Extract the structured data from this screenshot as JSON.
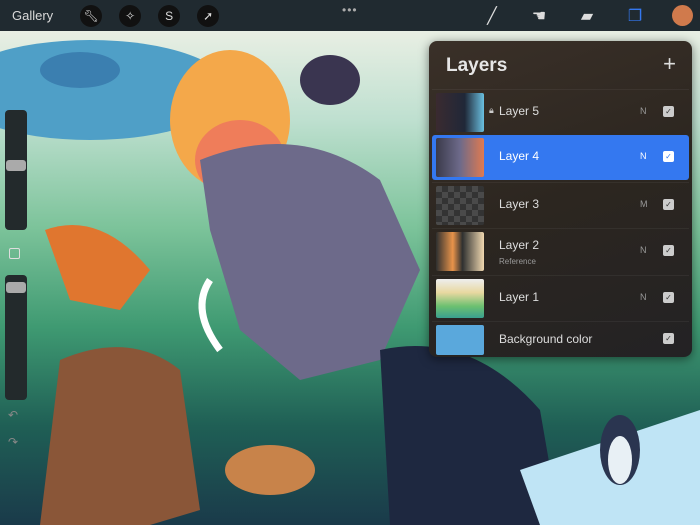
{
  "topbar": {
    "gallery": "Gallery",
    "more": "•••",
    "left_tools": [
      "wrench-icon",
      "magic-wand-icon",
      "selection-icon",
      "transform-arrow-icon"
    ],
    "right_tools": [
      "brush-icon",
      "smudge-icon",
      "eraser-icon",
      "layers-icon"
    ],
    "current_color": "#d07a4c",
    "accent": "#3478f0"
  },
  "layers": {
    "title": "Layers",
    "add": "+",
    "items": [
      {
        "name": "Layer 5",
        "mode": "N",
        "locked": true,
        "visible": true,
        "selected": false
      },
      {
        "name": "Layer 4",
        "mode": "N",
        "locked": false,
        "visible": true,
        "selected": true
      },
      {
        "name": "Layer 3",
        "mode": "M",
        "locked": false,
        "visible": true,
        "selected": false
      },
      {
        "name": "Layer 2",
        "sub": "Reference",
        "mode": "N",
        "locked": false,
        "visible": true,
        "selected": false
      },
      {
        "name": "Layer 1",
        "mode": "N",
        "locked": false,
        "visible": true,
        "selected": false
      }
    ],
    "background": {
      "name": "Background color",
      "color": "#5aa8dc",
      "visible": true
    }
  },
  "sidebar": {
    "brush_size": 0.8,
    "opacity": 0.5
  }
}
